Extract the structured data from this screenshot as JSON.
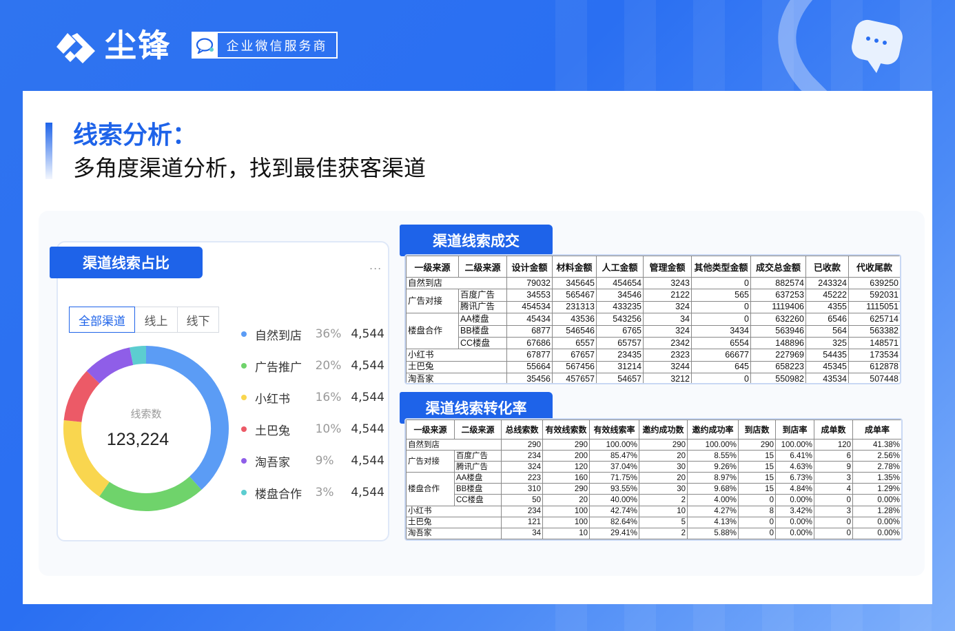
{
  "brand": {
    "name": "尘锋",
    "badge": "企业微信服务商"
  },
  "colors": {
    "accent": "#1e63e9",
    "bg_gradient_start": "#2f74f0"
  },
  "icons": {
    "logo": "chenfeng-logo-icon",
    "badge": "wecom-chat-icon",
    "deco": "chat-bubble-icon"
  },
  "title": {
    "main": "线索分析：",
    "sub": "多角度渠道分析，找到最佳获客渠道"
  },
  "left_panel": {
    "tag": "渠道线索占比",
    "more": "...",
    "filters": [
      "全部渠道",
      "线上",
      "线下"
    ],
    "active_filter": "全部渠道",
    "donut_label": "线索数",
    "donut_total": "123,224",
    "legend": [
      {
        "name": "自然到店",
        "pct": "36%",
        "value": "4,544",
        "color": "#5b9cf5"
      },
      {
        "name": "广告推广",
        "pct": "20%",
        "value": "4,544",
        "color": "#6fd36b"
      },
      {
        "name": "小红书",
        "pct": "16%",
        "value": "4,544",
        "color": "#f9d64f"
      },
      {
        "name": "土巴兔",
        "pct": "10%",
        "value": "4,544",
        "color": "#ec5a67"
      },
      {
        "name": "淘吾家",
        "pct": "9%",
        "value": "4,544",
        "color": "#8f5ee8"
      },
      {
        "name": "楼盘合作",
        "pct": "3%",
        "value": "4,544",
        "color": "#5ccdd0"
      }
    ]
  },
  "chart_data": {
    "type": "pie",
    "categories": [
      "自然到店",
      "广告推广",
      "小红书",
      "土巴兔",
      "淘吾家",
      "楼盘合作"
    ],
    "values": [
      36,
      20,
      16,
      10,
      9,
      3
    ],
    "colors": [
      "#5b9cf5",
      "#6fd36b",
      "#f9d64f",
      "#ec5a67",
      "#8f5ee8",
      "#5ccdd0"
    ],
    "title": "",
    "center_label": "线索数",
    "center_value": "123,224"
  },
  "table1": {
    "tag": "渠道线索成交",
    "headers": [
      "一级来源",
      "二级来源",
      "设计金额",
      "材料金额",
      "人工金额",
      "管理金额",
      "其他类型金额",
      "成交总金额",
      "已收款",
      "代收尾款"
    ],
    "rows": [
      {
        "l1": "自然到店",
        "l2": "",
        "span": 1,
        "vals": [
          "79032",
          "345645",
          "454654",
          "3243",
          "0",
          "882574",
          "243324",
          "639250"
        ]
      },
      {
        "l1": "广告对接",
        "l2": "百度广告",
        "span": 2,
        "vals": [
          "34553",
          "565467",
          "34546",
          "2122",
          "565",
          "637253",
          "45222",
          "592031"
        ]
      },
      {
        "l1": "",
        "l2": "腾讯广告",
        "span": 0,
        "vals": [
          "454534",
          "231313",
          "433235",
          "324",
          "0",
          "1119406",
          "4355",
          "1115051"
        ]
      },
      {
        "l1": "楼盘合作",
        "l2": "AA楼盘",
        "span": 3,
        "vals": [
          "45434",
          "43536",
          "543256",
          "34",
          "0",
          "632260",
          "6546",
          "625714"
        ]
      },
      {
        "l1": "",
        "l2": "BB楼盘",
        "span": 0,
        "vals": [
          "6877",
          "546546",
          "6765",
          "324",
          "3434",
          "563946",
          "564",
          "563382"
        ]
      },
      {
        "l1": "",
        "l2": "CC楼盘",
        "span": 0,
        "vals": [
          "67686",
          "6557",
          "65757",
          "2342",
          "6554",
          "148896",
          "325",
          "148571"
        ]
      },
      {
        "l1": "小红书",
        "l2": "",
        "span": 1,
        "vals": [
          "67877",
          "67657",
          "23435",
          "2323",
          "66677",
          "227969",
          "54435",
          "173534"
        ]
      },
      {
        "l1": "土巴兔",
        "l2": "",
        "span": 1,
        "vals": [
          "55664",
          "567456",
          "31214",
          "3244",
          "645",
          "658223",
          "45345",
          "612878"
        ]
      },
      {
        "l1": "淘吾家",
        "l2": "",
        "span": 1,
        "vals": [
          "35456",
          "457657",
          "54657",
          "3212",
          "0",
          "550982",
          "43534",
          "507448"
        ]
      }
    ]
  },
  "table2": {
    "tag": "渠道线索转化率",
    "headers": [
      "一级来源",
      "二级来源",
      "总线索数",
      "有效线索数",
      "有效线索率",
      "邀约成功数",
      "邀约成功率",
      "到店数",
      "到店率",
      "成单数",
      "成单率"
    ],
    "rows": [
      {
        "l1": "自然到店",
        "l2": "",
        "span": 1,
        "vals": [
          "290",
          "290",
          "100.00%",
          "290",
          "100.00%",
          "290",
          "100.00%",
          "120",
          "41.38%"
        ]
      },
      {
        "l1": "广告对接",
        "l2": "百度广告",
        "span": 2,
        "vals": [
          "234",
          "200",
          "85.47%",
          "20",
          "8.55%",
          "15",
          "6.41%",
          "6",
          "2.56%"
        ]
      },
      {
        "l1": "",
        "l2": "腾讯广告",
        "span": 0,
        "vals": [
          "324",
          "120",
          "37.04%",
          "30",
          "9.26%",
          "15",
          "4.63%",
          "9",
          "2.78%"
        ]
      },
      {
        "l1": "楼盘合作",
        "l2": "AA楼盘",
        "span": 3,
        "vals": [
          "223",
          "160",
          "71.75%",
          "20",
          "8.97%",
          "15",
          "6.73%",
          "3",
          "1.35%"
        ]
      },
      {
        "l1": "",
        "l2": "BB楼盘",
        "span": 0,
        "vals": [
          "310",
          "290",
          "93.55%",
          "30",
          "9.68%",
          "15",
          "4.84%",
          "4",
          "1.29%"
        ]
      },
      {
        "l1": "",
        "l2": "CC楼盘",
        "span": 0,
        "vals": [
          "50",
          "20",
          "40.00%",
          "2",
          "4.00%",
          "0",
          "0.00%",
          "0",
          "0.00%"
        ]
      },
      {
        "l1": "小红书",
        "l2": "",
        "span": 1,
        "vals": [
          "234",
          "100",
          "42.74%",
          "10",
          "4.27%",
          "8",
          "3.42%",
          "3",
          "1.28%"
        ]
      },
      {
        "l1": "土巴兔",
        "l2": "",
        "span": 1,
        "vals": [
          "121",
          "100",
          "82.64%",
          "5",
          "4.13%",
          "0",
          "0.00%",
          "0",
          "0.00%"
        ]
      },
      {
        "l1": "淘吾家",
        "l2": "",
        "span": 1,
        "vals": [
          "34",
          "10",
          "29.41%",
          "2",
          "5.88%",
          "0",
          "0.00%",
          "0",
          "0.00%"
        ]
      }
    ]
  }
}
